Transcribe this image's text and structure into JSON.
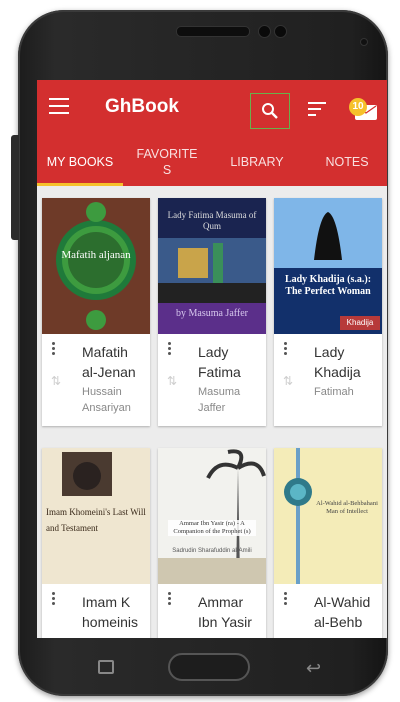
{
  "app": {
    "title": "GhBook",
    "notification_count": "10"
  },
  "tabs": [
    {
      "label": "MY BOOKS",
      "active": true
    },
    {
      "label": "FAVORITE\nS",
      "active": false
    },
    {
      "label": "LIBRARY",
      "active": false
    },
    {
      "label": "NOTES",
      "active": false
    }
  ],
  "books": [
    {
      "title": "Mafatih al-Jenan",
      "author": "Hussain Ansariyan",
      "cover_text": "Mafatih aljanan"
    },
    {
      "title": "Lady Fatima",
      "author": "Masuma Jaffer",
      "cover_text_top": "Lady Fatima Masuma of Qum",
      "cover_text_bottom": "by Masuma Jaffer"
    },
    {
      "title": "Lady Khadija",
      "author": "Fatimah",
      "cover_text": "Lady Khadija (s.a.): The Perfect Woman",
      "cover_text_tag": "Khadija"
    },
    {
      "title": "Imam K homeinis",
      "author": "",
      "cover_text": "Imam Khomeini's Last Will and Testament"
    },
    {
      "title": "Ammar Ibn Yasir",
      "author": "",
      "cover_text": "Ammar Ibn Yasir (ra) - A Companion of the Prophet (s)",
      "cover_text_sub": "Sadrudin Sharafuddin al-Amili"
    },
    {
      "title": "Al-Wahid al-Behb",
      "author": "",
      "cover_text": "Al-Wahid al-Behbahani Man of Intellect"
    }
  ],
  "colors": {
    "appbar": "#d32f2f",
    "accent": "#f6c12b",
    "focus": "#6ab04c"
  }
}
